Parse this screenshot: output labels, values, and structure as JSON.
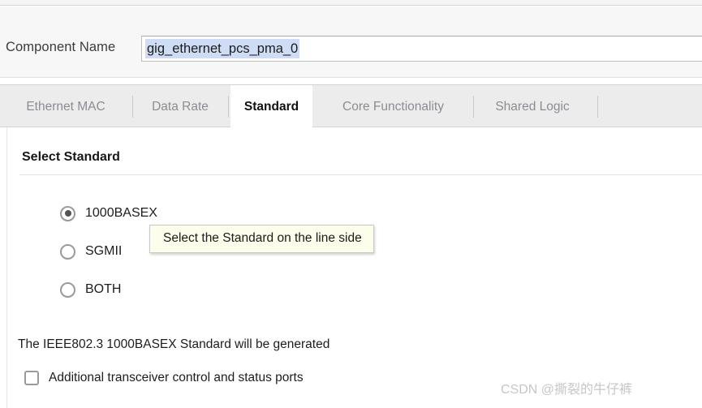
{
  "component_name": {
    "label": "Component Name",
    "value": "gig_ethernet_pcs_pma_0",
    "placeholder": "Component Name"
  },
  "tabs": [
    {
      "label": "Ethernet MAC",
      "active": false
    },
    {
      "label": "Data Rate",
      "active": false
    },
    {
      "label": "Standard",
      "active": true
    },
    {
      "label": "Core Functionality",
      "active": false
    },
    {
      "label": "Shared Logic",
      "active": false
    }
  ],
  "panel": {
    "section_title": "Select Standard",
    "radio_options": [
      {
        "label": "1000BASEX",
        "selected": true
      },
      {
        "label": "SGMII",
        "selected": false
      },
      {
        "label": "BOTH",
        "selected": false
      }
    ],
    "tooltip": "Select the Standard on the line side",
    "status_text": "The IEEE802.3 1000BASEX Standard will be generated",
    "checkbox": {
      "label": "Additional transceiver control and status ports",
      "checked": false
    }
  },
  "watermark": "CSDN @撕裂的牛仔裤",
  "colors": {
    "tab_bar_bg": "#ececec",
    "active_tab_bg": "#ffffff",
    "panel_bg": "#ffffff",
    "selection_highlight": "#cfdcf5",
    "tooltip_bg": "#fdfdeb",
    "tooltip_border": "#c8c8c8",
    "inactive_tab_text": "#8b8d93",
    "watermark_text": "#c6c6c6"
  }
}
